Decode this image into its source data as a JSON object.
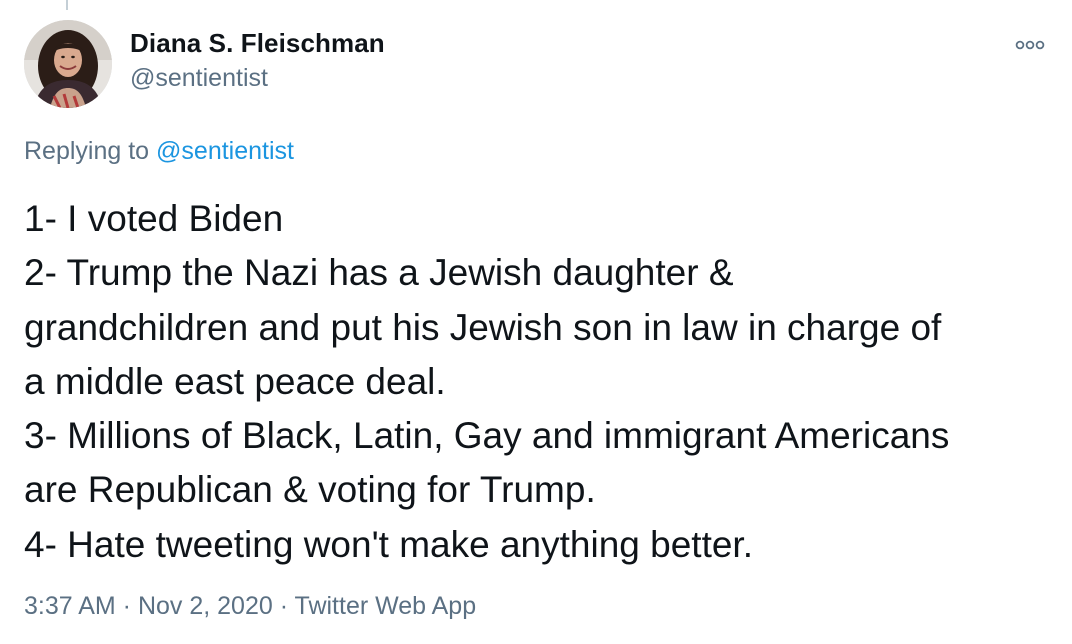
{
  "author": {
    "name": "Diana S. Fleischman",
    "handle": "@sentientist",
    "avatar_icon": "profile-photo"
  },
  "reply": {
    "prefix": "Replying to ",
    "mention": "@sentientist"
  },
  "tweet": {
    "lines": [
      "1- I voted Biden",
      "2- Trump the Nazi has a Jewish daughter &",
      "grandchildren and put his Jewish son in law in charge of",
      "a middle east peace deal.",
      "3- Millions of Black, Latin, Gay and immigrant Americans",
      "are Republican & voting for Trump.",
      "4- Hate tweeting won't make anything better."
    ]
  },
  "meta": {
    "time": "3:37 AM",
    "separator": " · ",
    "date": "Nov 2, 2020",
    "source": "Twitter Web App"
  },
  "more_icon": "more-horizontal-icon",
  "colors": {
    "text_primary": "#0f1419",
    "text_secondary": "#5b7083",
    "link": "#1b95e0"
  }
}
